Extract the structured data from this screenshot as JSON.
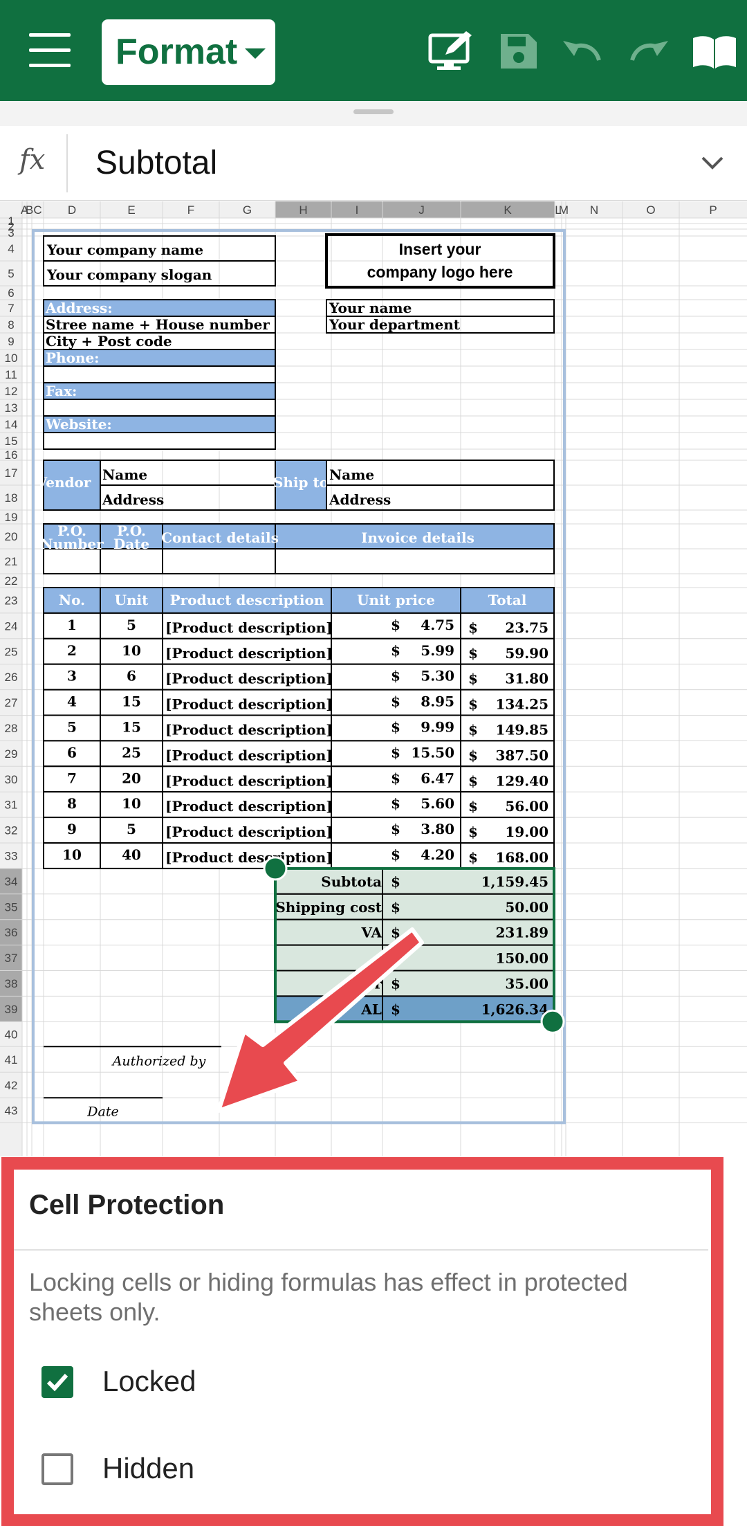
{
  "toolbar": {
    "format_label": "Format",
    "icons": [
      "menu-icon",
      "edit-mode-icon",
      "save-icon",
      "undo-icon",
      "redo-icon",
      "read-mode-icon"
    ]
  },
  "formula_bar": {
    "fx": "fx",
    "value": "Subtotal"
  },
  "colors": {
    "brand": "#107040",
    "header_fill": "#8eb4e3",
    "selected_fill": "#d9e7de",
    "annotation": "#e84a4f"
  },
  "sheet": {
    "columns": [
      "A",
      "B",
      "C",
      "D",
      "E",
      "F",
      "G",
      "H",
      "I",
      "J",
      "K",
      "L",
      "M",
      "N",
      "O",
      "P"
    ],
    "rows": [
      "1",
      "2",
      "3",
      "4",
      "5",
      "6",
      "7",
      "8",
      "9",
      "10",
      "11",
      "12",
      "13",
      "14",
      "15",
      "16",
      "17",
      "18",
      "19",
      "20",
      "21",
      "22",
      "23",
      "24",
      "25",
      "26",
      "27",
      "28",
      "29",
      "30",
      "31",
      "32",
      "33",
      "34",
      "35",
      "36",
      "37",
      "38",
      "39",
      "40",
      "41",
      "42",
      "43"
    ],
    "company_name": "Your company name",
    "company_slogan": "Your company slogan",
    "logo_line1": "Insert your",
    "logo_line2": "company logo here",
    "address_label": "Address:",
    "street": "Stree name + House number",
    "city": "City + Post code",
    "phone_label": "Phone:",
    "fax_label": "Fax:",
    "website_label": "Website:",
    "your_name": "Your name",
    "your_department": "Your department",
    "vendor_label": "Vendor",
    "ship_to_label": "Ship to",
    "vendor_name": "Name",
    "vendor_address": "Address",
    "ship_name": "Name",
    "ship_address": "Address",
    "po_number": [
      "P.O.",
      "Number"
    ],
    "po_date": [
      "P.O.",
      "Date"
    ],
    "contact_details": "Contact details",
    "invoice_details": "Invoice details",
    "item_headers": [
      "No.",
      "Unit",
      "Product description",
      "Unit price",
      "Total"
    ],
    "items": [
      {
        "no": "1",
        "unit": "5",
        "desc": "[Product description]",
        "price": "4.75",
        "total": "23.75"
      },
      {
        "no": "2",
        "unit": "10",
        "desc": "[Product description]",
        "price": "5.99",
        "total": "59.90"
      },
      {
        "no": "3",
        "unit": "6",
        "desc": "[Product description]",
        "price": "5.30",
        "total": "31.80"
      },
      {
        "no": "4",
        "unit": "15",
        "desc": "[Product description]",
        "price": "8.95",
        "total": "134.25"
      },
      {
        "no": "5",
        "unit": "15",
        "desc": "[Product description]",
        "price": "9.99",
        "total": "149.85"
      },
      {
        "no": "6",
        "unit": "25",
        "desc": "[Product description]",
        "price": "15.50",
        "total": "387.50"
      },
      {
        "no": "7",
        "unit": "20",
        "desc": "[Product description]",
        "price": "6.47",
        "total": "129.40"
      },
      {
        "no": "8",
        "unit": "10",
        "desc": "[Product description]",
        "price": "5.60",
        "total": "56.00"
      },
      {
        "no": "9",
        "unit": "5",
        "desc": "[Product description]",
        "price": "3.80",
        "total": "19.00"
      },
      {
        "no": "10",
        "unit": "40",
        "desc": "[Product description]",
        "price": "4.20",
        "total": "168.00"
      }
    ],
    "currency": "$",
    "summary": [
      {
        "label": "Subtota",
        "value": "1,159.45"
      },
      {
        "label": "Shipping cost",
        "value": "50.00"
      },
      {
        "label": "VA",
        "value": "231.89"
      },
      {
        "label": "",
        "value": "150.00"
      },
      {
        "label": "ther",
        "value": "35.00"
      },
      {
        "label": "AL",
        "value": "1,626.34"
      }
    ],
    "authorized_by": "Authorized by",
    "date_label": "Date"
  },
  "cell_protection": {
    "title": "Cell Protection",
    "description": "Locking cells or hiding formulas has effect in protected sheets only.",
    "options": [
      {
        "label": "Locked",
        "checked": true
      },
      {
        "label": "Hidden",
        "checked": false
      }
    ]
  }
}
